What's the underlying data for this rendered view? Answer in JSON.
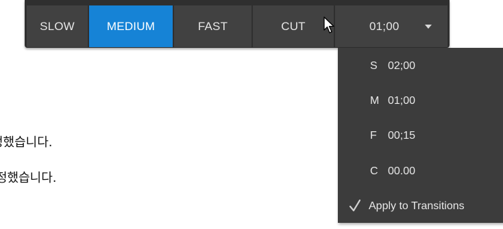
{
  "toolbar": {
    "buttons": {
      "slow": "SLOW",
      "medium": "MEDIUM",
      "fast": "FAST",
      "cut": "CUT"
    },
    "selected": "medium",
    "duration_value": "01;00",
    "accent_color": "#1683d6"
  },
  "dropdown": {
    "options": [
      {
        "key": "S",
        "value": "02;00"
      },
      {
        "key": "M",
        "value": "01;00"
      },
      {
        "key": "F",
        "value": "00;15"
      },
      {
        "key": "C",
        "value": "00.00"
      }
    ],
    "apply_label": "Apply to Transitions",
    "apply_checked": true
  },
  "document": {
    "line1": "정했습니다.",
    "line2": "정했습니다."
  },
  "icons": {
    "caret": "chevron-down-icon",
    "check": "check-icon",
    "cursor": "mouse-cursor-icon"
  }
}
